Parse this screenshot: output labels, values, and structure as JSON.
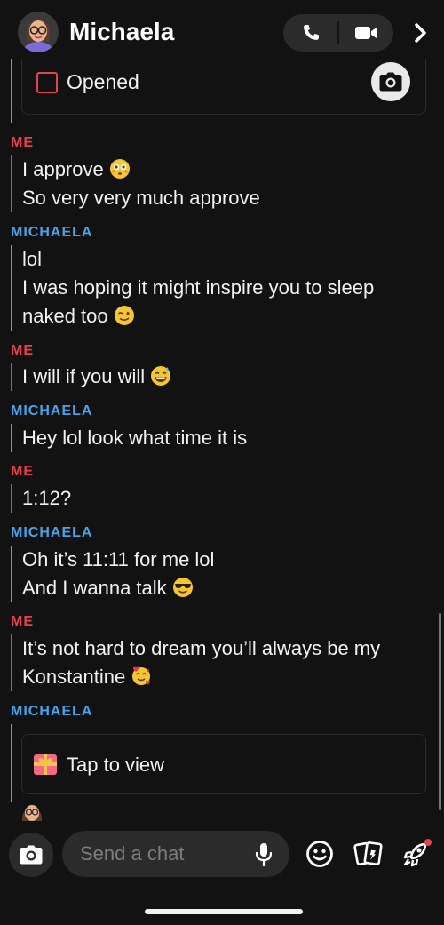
{
  "header": {
    "title": "Michaela",
    "call_icon": "phone-icon",
    "video_icon": "video-camera-icon",
    "more_icon": "chevron-right-icon"
  },
  "opened_item": {
    "label": "Opened",
    "icon": "camera-icon"
  },
  "conversation": [
    {
      "sender": "ME",
      "lines": [
        "I approve",
        "So very very much approve"
      ]
    },
    {
      "sender": "MICHAELA",
      "lines": [
        "lol",
        "I was hoping it might inspire you to sleep",
        "naked too"
      ]
    },
    {
      "sender": "ME",
      "lines": [
        "I will if you will"
      ]
    },
    {
      "sender": "MICHAELA",
      "lines": [
        "Hey lol look what time it is"
      ]
    },
    {
      "sender": "ME",
      "lines": [
        "1:12?"
      ]
    },
    {
      "sender": "MICHAELA",
      "lines": [
        "Oh it’s 11:11 for me lol",
        "And I wanna talk"
      ]
    },
    {
      "sender": "ME",
      "lines": [
        "It’s not hard to dream you’ll always be my",
        "Konstantine"
      ]
    },
    {
      "sender": "MICHAELA",
      "lines": []
    }
  ],
  "snap": {
    "label": "Tap to view",
    "icon": "gift-icon"
  },
  "composer": {
    "placeholder": "Send a chat",
    "icons": [
      "camera-icon",
      "microphone-icon",
      "smiley-icon",
      "cards-icon",
      "rocket-icon"
    ]
  },
  "colors": {
    "me": "#e5424f",
    "them": "#4aa3e8",
    "background": "#121212"
  }
}
